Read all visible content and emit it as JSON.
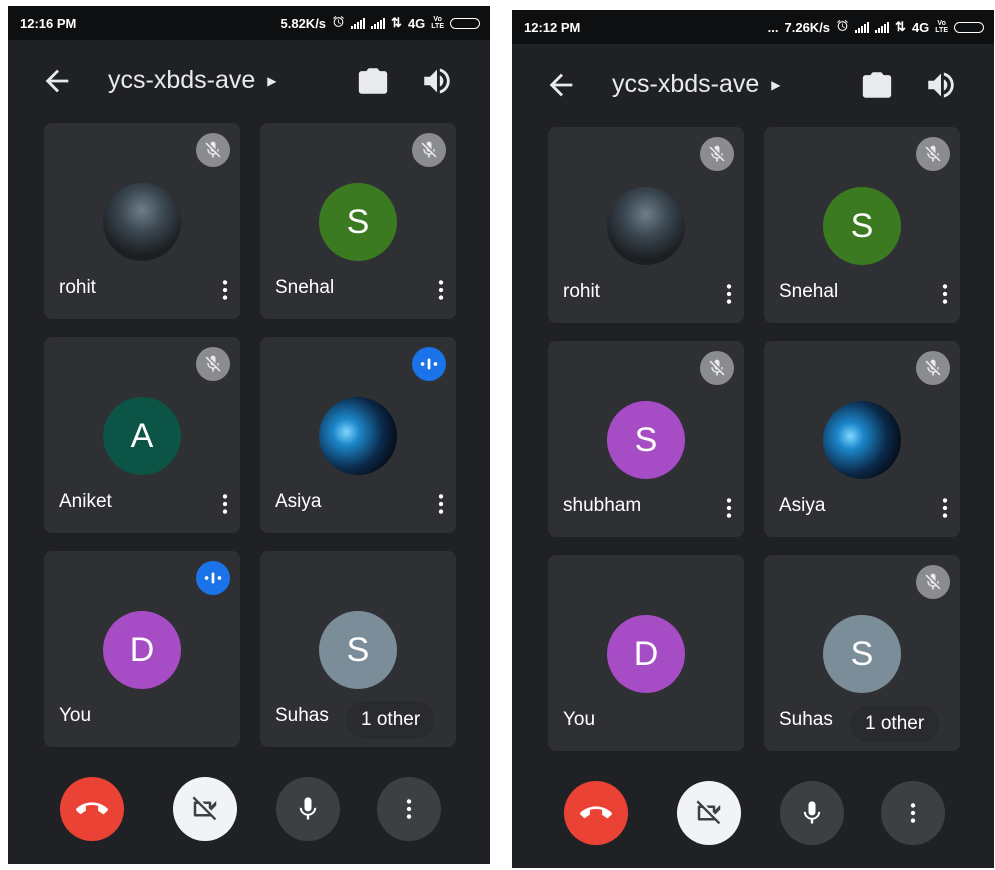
{
  "colors": {
    "phone_bg": "#202124",
    "tile_bg": "#2f3034",
    "end_call": "#ea4335",
    "speaking": "#1a73e8",
    "muted_badge": "#8b8c8f"
  },
  "screens": [
    {
      "status_bar": {
        "time": "12:16 PM",
        "speed": "5.82K/s",
        "network": "4G",
        "extra": ""
      },
      "meeting_code": "ycs-xbds-ave",
      "participants": [
        {
          "name": "rohit",
          "initial": "",
          "avatar": "photo",
          "avatar_color": "",
          "status": "muted"
        },
        {
          "name": "Snehal",
          "initial": "S",
          "avatar": "letter",
          "avatar_color": "#3b7a20",
          "status": "muted"
        },
        {
          "name": "Aniket",
          "initial": "A",
          "avatar": "letter",
          "avatar_color": "#0b5446",
          "status": "muted"
        },
        {
          "name": "Asiya",
          "initial": "",
          "avatar": "photo",
          "avatar_color": "",
          "status": "speaking"
        },
        {
          "name": "You",
          "initial": "D",
          "avatar": "letter",
          "avatar_color": "#a64cc4",
          "status": "speaking"
        },
        {
          "name": "Suhas",
          "initial": "S",
          "avatar": "letter",
          "avatar_color": "#7a8d99",
          "status": "none",
          "others": "1 other"
        }
      ]
    },
    {
      "status_bar": {
        "time": "12:12 PM",
        "speed": "7.26K/s",
        "network": "4G",
        "extra": "..."
      },
      "meeting_code": "ycs-xbds-ave",
      "participants": [
        {
          "name": "rohit",
          "initial": "",
          "avatar": "photo",
          "avatar_color": "",
          "status": "muted"
        },
        {
          "name": "Snehal",
          "initial": "S",
          "avatar": "letter",
          "avatar_color": "#3b7a20",
          "status": "muted"
        },
        {
          "name": "shubham",
          "initial": "S",
          "avatar": "letter",
          "avatar_color": "#a64cc4",
          "status": "muted"
        },
        {
          "name": "Asiya",
          "initial": "",
          "avatar": "photo",
          "avatar_color": "",
          "status": "muted"
        },
        {
          "name": "You",
          "initial": "D",
          "avatar": "letter",
          "avatar_color": "#a64cc4",
          "status": "none"
        },
        {
          "name": "Suhas",
          "initial": "S",
          "avatar": "letter",
          "avatar_color": "#7a8d99",
          "status": "muted",
          "others": "1 other"
        }
      ]
    }
  ],
  "icons": {
    "back": "arrow-left-icon",
    "camera_switch": "camera-flip-icon",
    "speaker": "volume-icon",
    "end_call": "end-call-icon",
    "camera_off": "videocam-off-icon",
    "mic": "mic-icon",
    "more": "more-vert-icon",
    "muted": "mic-off-icon",
    "speaking": "audio-levels-icon",
    "alarm": "alarm-icon"
  }
}
